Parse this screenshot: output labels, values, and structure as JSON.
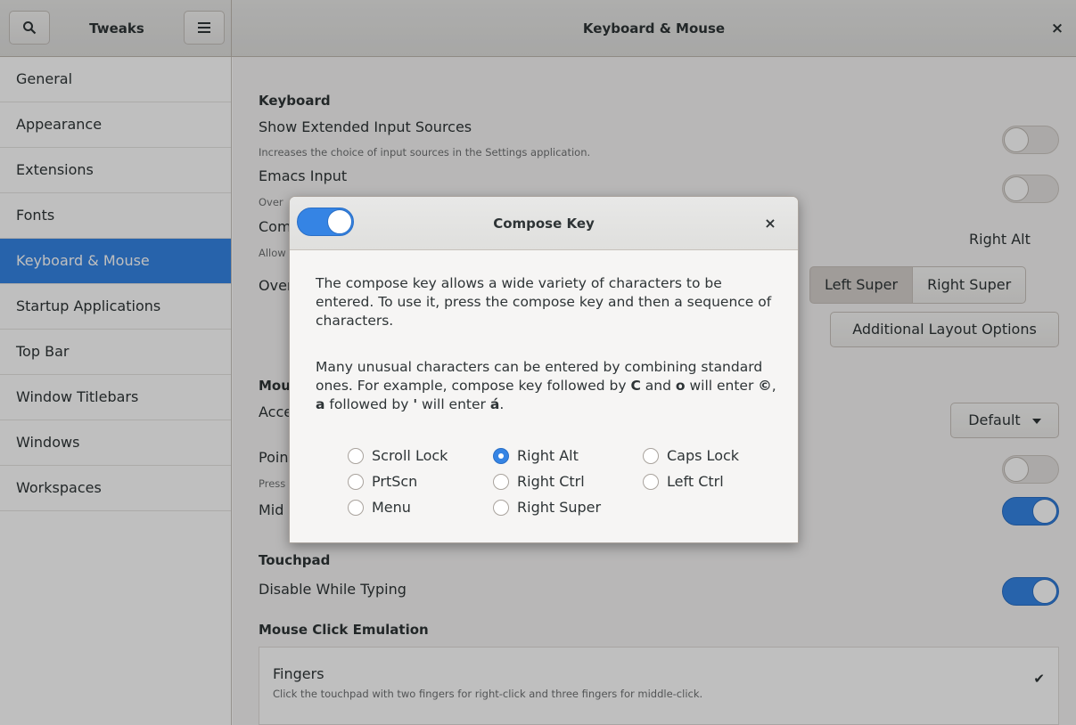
{
  "header": {
    "app_title": "Tweaks",
    "title": "Keyboard & Mouse",
    "search_icon": "search-icon",
    "menu_icon": "menu-icon",
    "close_glyph": "×"
  },
  "sidebar": {
    "items": [
      {
        "label": "General"
      },
      {
        "label": "Appearance"
      },
      {
        "label": "Extensions"
      },
      {
        "label": "Fonts"
      },
      {
        "label": "Keyboard & Mouse",
        "active": true
      },
      {
        "label": "Startup Applications"
      },
      {
        "label": "Top Bar"
      },
      {
        "label": "Window Titlebars"
      },
      {
        "label": "Windows"
      },
      {
        "label": "Workspaces"
      }
    ]
  },
  "main": {
    "keyboard_heading": "Keyboard",
    "ext_input_label": "Show Extended Input Sources",
    "ext_input_desc": "Increases the choice of input sources in the Settings application.",
    "emacs_label": "Emacs Input",
    "emacs_desc_partial": "Over",
    "compose_label_partial": "Com",
    "compose_desc_partial": "Allow",
    "compose_value": "Right Alt",
    "overview_label_partial": "Over",
    "overview_options": [
      "Left Super",
      "Right Super"
    ],
    "additional_layout_button": "Additional Layout Options",
    "mouse_heading_partial": "Mou",
    "accel_label_partial": "Acce",
    "accel_value": "Default",
    "pointer_label_partial": "Poin",
    "pointer_desc_partial": "Press",
    "middle_label_partial": "Mid",
    "touchpad_heading": "Touchpad",
    "disable_typing_label": "Disable While Typing",
    "click_emulation_heading": "Mouse Click Emulation",
    "fingers_title": "Fingers",
    "fingers_desc": "Click the touchpad with two fingers for right-click and three fingers for middle-click.",
    "check_glyph": "✔"
  },
  "switches": {
    "ext_input": false,
    "emacs": false,
    "pointer": false,
    "middle_click": true,
    "disable_typing": true,
    "compose_enabled": true
  },
  "dialog": {
    "title": "Compose Key",
    "close_glyph": "×",
    "para1": "The compose key allows a wide variety of characters to be entered. To use it, press the compose key and then a sequence of characters.",
    "para2_a": "Many unusual characters can be entered by combining standard ones. For example, compose key followed by ",
    "para2_c": "C",
    "para2_and": " and ",
    "para2_o": "o",
    "para2_b": " will enter ",
    "para2_copy": "©",
    "para2_comma": ", ",
    "para2_a2": "a",
    "para2_fb": " followed by ",
    "para2_apos": "'",
    "para2_we": " will enter ",
    "para2_aacute": "á",
    "para2_end": ".",
    "options": [
      {
        "label": "Scroll Lock",
        "selected": false
      },
      {
        "label": "Right Alt",
        "selected": true
      },
      {
        "label": "Caps Lock",
        "selected": false
      },
      {
        "label": "PrtScn",
        "selected": false
      },
      {
        "label": "Right Ctrl",
        "selected": false
      },
      {
        "label": "Left Ctrl",
        "selected": false
      },
      {
        "label": "Menu",
        "selected": false
      },
      {
        "label": "Right Super",
        "selected": false
      }
    ]
  }
}
